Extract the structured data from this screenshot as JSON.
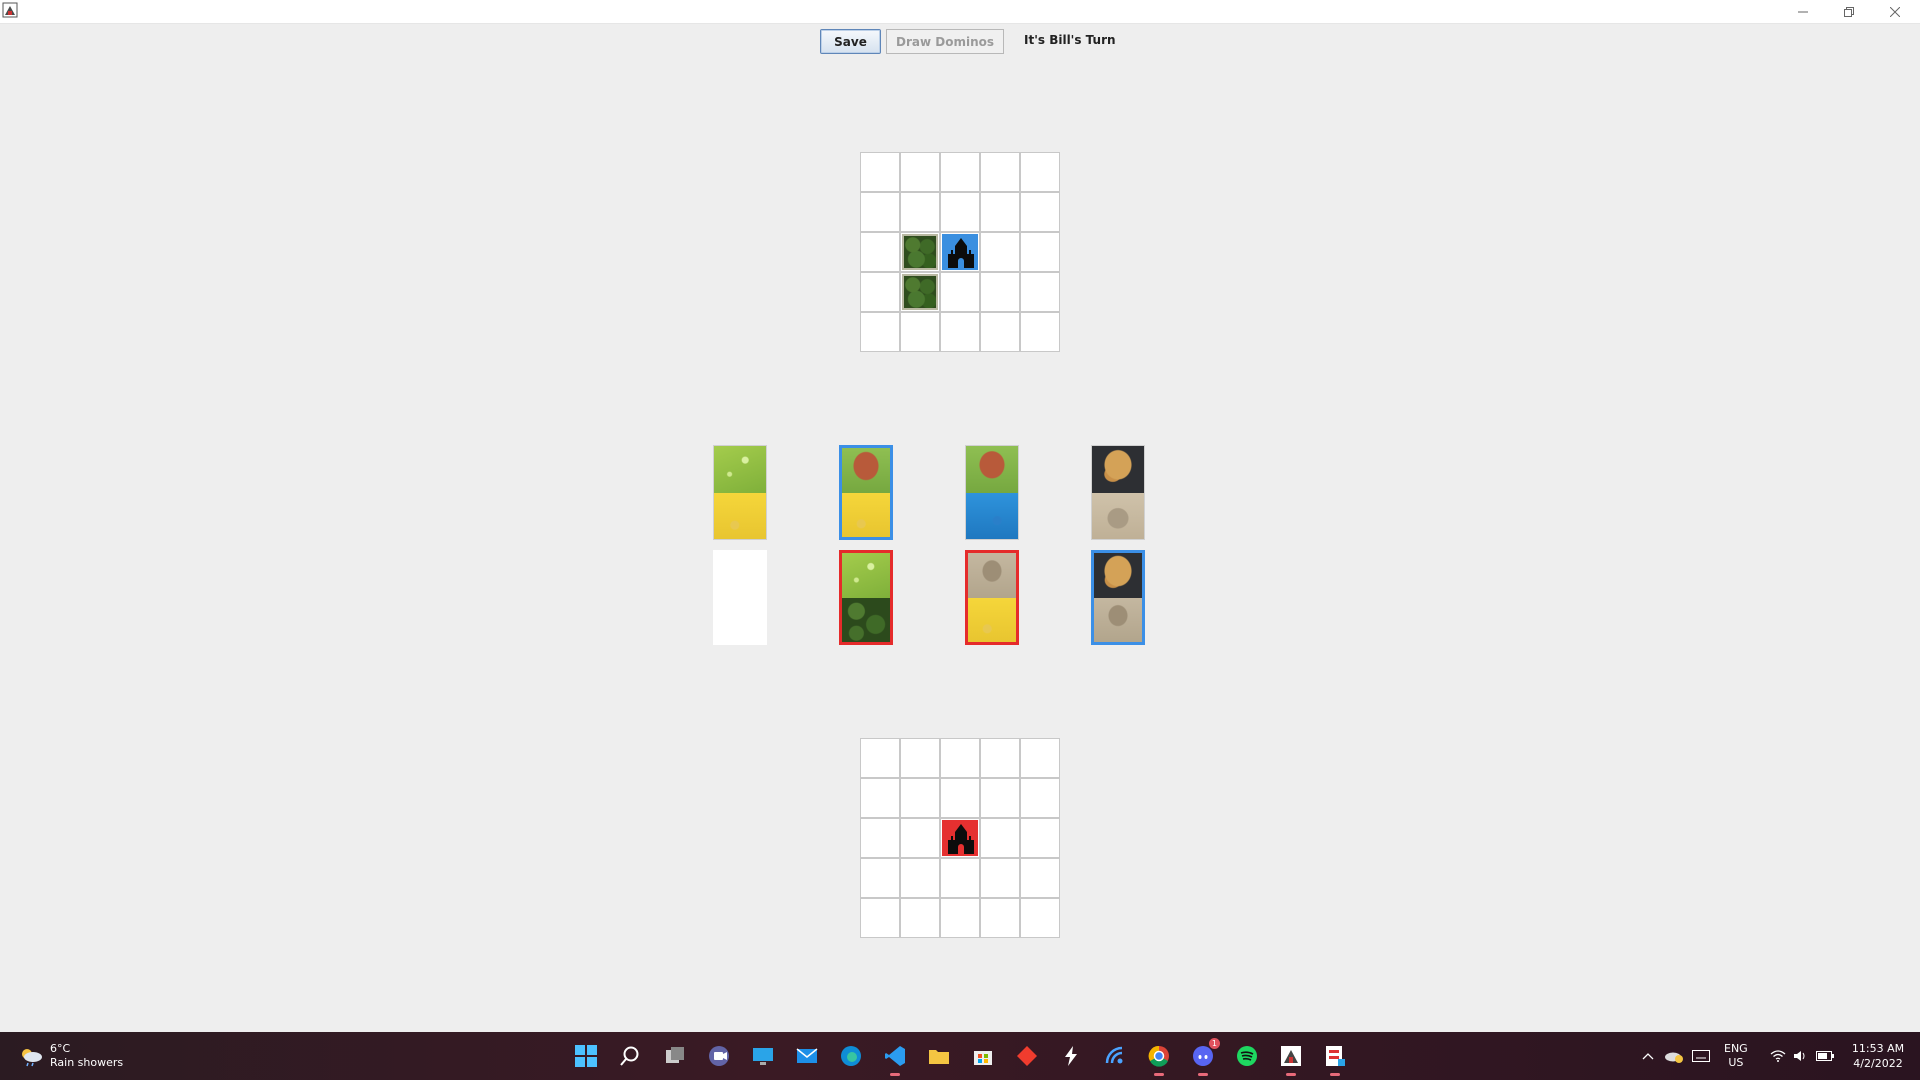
{
  "window": {
    "title": "",
    "controls": {
      "minimize": "minimize-icon",
      "maximize": "restore-icon",
      "close": "close-icon"
    }
  },
  "toolbar": {
    "save_label": "Save",
    "draw_label": "Draw Dominos",
    "draw_enabled": false,
    "turn_text": "It's Bill's Turn"
  },
  "boards": [
    {
      "player_color": "#3a8fe0",
      "grid": [
        [
          "",
          "",
          "",
          "",
          ""
        ],
        [
          "",
          "",
          "",
          "",
          ""
        ],
        [
          "",
          "forest",
          "castle-blue",
          "",
          ""
        ],
        [
          "",
          "forest",
          "",
          "",
          ""
        ],
        [
          "",
          "",
          "",
          "",
          ""
        ]
      ]
    },
    {
      "player_color": "#e53030",
      "grid": [
        [
          "",
          "",
          "",
          "",
          ""
        ],
        [
          "",
          "",
          "",
          "",
          ""
        ],
        [
          "",
          "",
          "castle-red",
          "",
          ""
        ],
        [
          "",
          "",
          "",
          "",
          ""
        ],
        [
          "",
          "",
          "",
          "",
          ""
        ]
      ]
    }
  ],
  "dominoes": {
    "current_row": [
      {
        "top": "grass",
        "bottom": "wheat",
        "owner": "none"
      },
      {
        "top": "swamp",
        "bottom": "wheat",
        "owner": "blue"
      },
      {
        "top": "swamp",
        "bottom": "water",
        "owner": "none"
      },
      {
        "top": "mine",
        "bottom": "desert",
        "owner": "none"
      }
    ],
    "next_row": [
      {
        "top": "",
        "bottom": "",
        "owner": "empty"
      },
      {
        "top": "grass",
        "bottom": "forest",
        "owner": "red"
      },
      {
        "top": "rock",
        "bottom": "wheat",
        "owner": "red"
      },
      {
        "top": "mine",
        "bottom": "rock",
        "owner": "blue"
      }
    ]
  },
  "taskbar": {
    "weather": {
      "temp": "6°C",
      "desc": "Rain showers",
      "icon": "cloud-rain-icon"
    },
    "apps": [
      "start-icon",
      "search-icon",
      "task-view-icon",
      "teams-icon",
      "desktop-icon",
      "mail-icon",
      "edge-icon",
      "vscode-icon",
      "file-explorer-icon",
      "store-icon",
      "git-icon",
      "bolt-icon",
      "network-app-icon",
      "chrome-icon",
      "discord-icon",
      "spotify-icon",
      "java-app-icon",
      "game-app-icon"
    ],
    "discord_badge": "1",
    "lang_line1": "ENG",
    "lang_line2": "US",
    "time": "11:53 AM",
    "date": "4/2/2022"
  }
}
